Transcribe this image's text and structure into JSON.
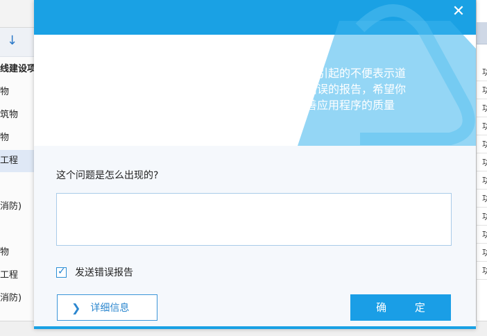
{
  "background": {
    "sort_icon": "↓",
    "tree": [
      {
        "label": "线建设项",
        "bold": true,
        "selected": false
      },
      {
        "label": "物",
        "bold": false,
        "selected": false
      },
      {
        "label": "筑物",
        "bold": false,
        "selected": false
      },
      {
        "label": "物",
        "bold": false,
        "selected": false
      },
      {
        "label": "工程",
        "bold": false,
        "selected": true
      },
      {
        "label": "",
        "bold": false,
        "selected": false
      },
      {
        "label": "消防)",
        "bold": false,
        "selected": false
      },
      {
        "label": "",
        "bold": false,
        "selected": false
      },
      {
        "label": "物",
        "bold": false,
        "selected": false
      },
      {
        "label": "工程",
        "bold": false,
        "selected": false
      },
      {
        "label": "消防)",
        "bold": false,
        "selected": false
      }
    ],
    "right_cells": [
      "功",
      "功",
      "功",
      "功",
      "功",
      "功",
      "功",
      "功",
      "功",
      "功",
      "功",
      "功"
    ]
  },
  "dialog": {
    "close_icon": "close-icon",
    "accent_color": "#1aa1e4",
    "message_lines": [
      "应用程序发生未知错误，我们对此引起的不便表示道",
      "歉，我们已经产生了一个关于此错误的报告，希望你",
      "选择发送此报告给我们以帮助改善应用程序的质量"
    ],
    "question": "这个问题是怎么出现的?",
    "description_value": "",
    "description_placeholder": "",
    "send_report_checked": true,
    "send_report_label": "发送错误报告",
    "details_button": "详细信息",
    "ok_button": "确 定"
  }
}
